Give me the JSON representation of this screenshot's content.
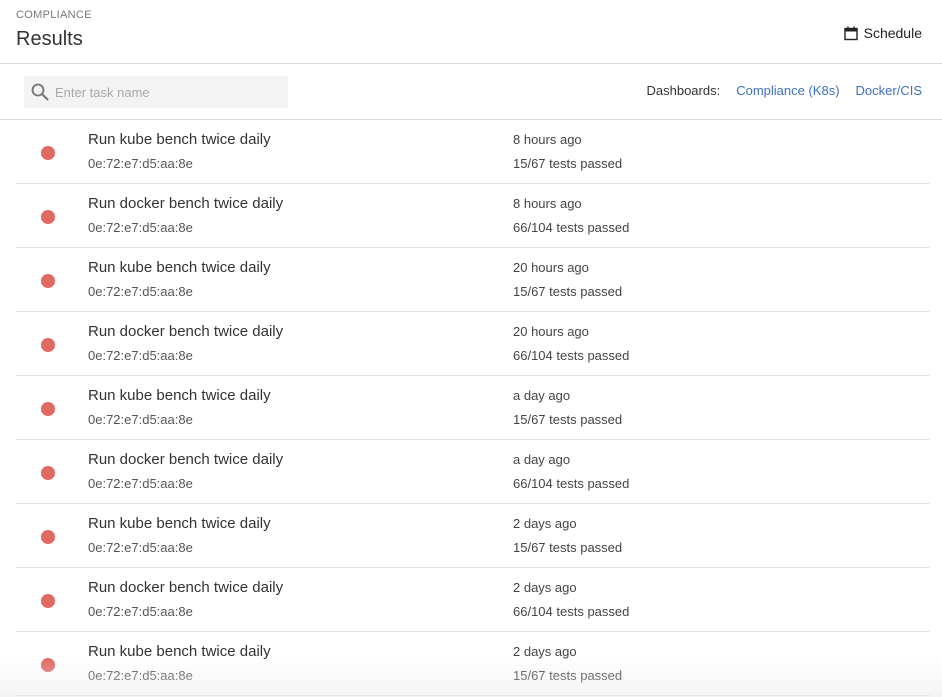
{
  "header": {
    "section_label": "COMPLIANCE",
    "title": "Results",
    "schedule_label": "Schedule",
    "schedule_icon": "calendar-icon"
  },
  "toolbar": {
    "search": {
      "placeholder": "Enter task name",
      "value": "",
      "icon": "search-icon"
    },
    "dashboards_label": "Dashboards:",
    "dashboard_links": [
      "Compliance (K8s)",
      "Docker/CIS"
    ]
  },
  "colors": {
    "status_failed": "#e06a62",
    "link": "#3f6fc2"
  },
  "tasks": [
    {
      "name": "Run kube bench twice daily",
      "id": "0e:72:e7:d5:aa:8e",
      "time": "8 hours ago",
      "result": "15/67 tests passed"
    },
    {
      "name": "Run docker bench twice daily",
      "id": "0e:72:e7:d5:aa:8e",
      "time": "8 hours ago",
      "result": "66/104 tests passed"
    },
    {
      "name": "Run kube bench twice daily",
      "id": "0e:72:e7:d5:aa:8e",
      "time": "20 hours ago",
      "result": "15/67 tests passed"
    },
    {
      "name": "Run docker bench twice daily",
      "id": "0e:72:e7:d5:aa:8e",
      "time": "20 hours ago",
      "result": "66/104 tests passed"
    },
    {
      "name": "Run kube bench twice daily",
      "id": "0e:72:e7:d5:aa:8e",
      "time": "a day ago",
      "result": "15/67 tests passed"
    },
    {
      "name": "Run docker bench twice daily",
      "id": "0e:72:e7:d5:aa:8e",
      "time": "a day ago",
      "result": "66/104 tests passed"
    },
    {
      "name": "Run kube bench twice daily",
      "id": "0e:72:e7:d5:aa:8e",
      "time": "2 days ago",
      "result": "15/67 tests passed"
    },
    {
      "name": "Run docker bench twice daily",
      "id": "0e:72:e7:d5:aa:8e",
      "time": "2 days ago",
      "result": "66/104 tests passed"
    },
    {
      "name": "Run kube bench twice daily",
      "id": "0e:72:e7:d5:aa:8e",
      "time": "2 days ago",
      "result": "15/67 tests passed"
    }
  ]
}
